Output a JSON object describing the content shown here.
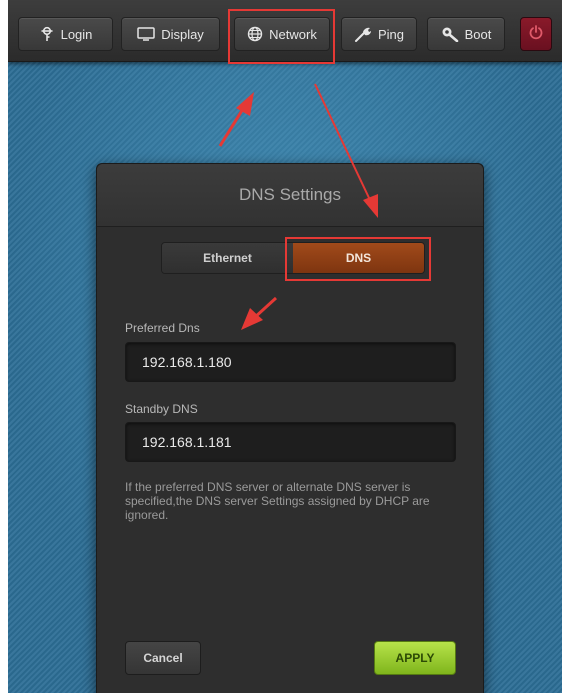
{
  "toolbar": {
    "login_label": "Login",
    "display_label": "Display",
    "network_label": "Network",
    "ping_label": "Ping",
    "boot_label": "Boot"
  },
  "dialog": {
    "title": "DNS Settings",
    "tabs": [
      {
        "label": "Ethernet",
        "selected": false
      },
      {
        "label": "DNS",
        "selected": true
      }
    ],
    "preferred_label": "Preferred Dns",
    "preferred_value": "192.168.1.180",
    "standby_label": "Standby DNS",
    "standby_value": "192.168.1.181",
    "note": "If the preferred DNS server or alternate DNS server is specified,the DNS server Settings assigned by DHCP are ignored.",
    "cancel_label": "Cancel",
    "apply_label": "APPLY"
  },
  "colors": {
    "annotation": "#e53935",
    "apply": "#9ccc2e",
    "dns_tab": "#8c3f14",
    "power": "#7a1424"
  },
  "icons": [
    "login-icon",
    "display-icon",
    "network-icon",
    "ping-icon",
    "boot-icon",
    "power-icon"
  ]
}
